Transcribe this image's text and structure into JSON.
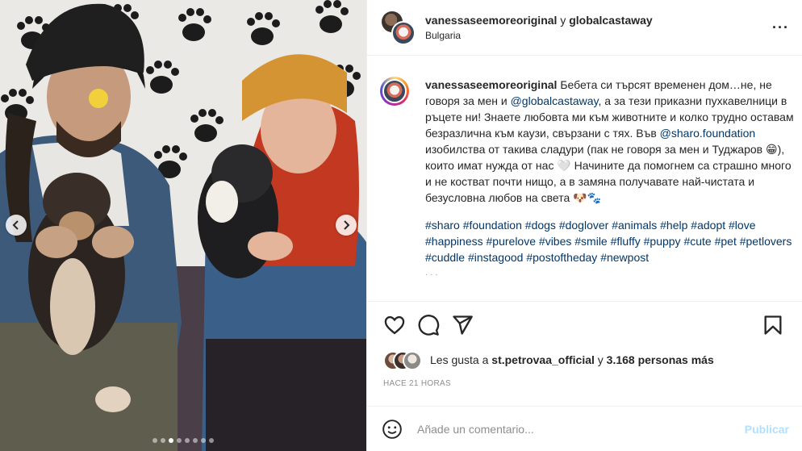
{
  "header": {
    "user1": "vanessaseemoreoriginal",
    "conjunction": "y",
    "user2": "globalcastaway",
    "location": "Bulgaria",
    "more_icon": "more-horizontal-icon"
  },
  "caption": {
    "username": "vanessaseemoreoriginal",
    "text_1": "Бебета си търсят временен дом…не, не говоря за мен и ",
    "mention_1": "@globalcastaway",
    "text_2": ", а за тези приказни пухкавелници в ръцете ни! Знаете любовта ми към животните и колко трудно оставам безразлична към каузи, свързани с тях. Във ",
    "mention_2": "@sharo.foundation",
    "text_3": " изобилства от такива сладури (пак не говоря за мен и Туджаров 😁), които имат нужда от нас 🤍 Начините да помогнем са страшно много и не костват почти нищо, а в замяна получавате най-чистата и безусловна любов на света 🐶🐾",
    "hashtags": [
      "#sharo",
      "#foundation",
      "#dogs",
      "#doglover",
      "#animals",
      "#help",
      "#adopt",
      "#love",
      "#happiness",
      "#purelove",
      "#vibes",
      "#smile",
      "#fluffy",
      "#puppy",
      "#cute",
      "#pet",
      "#petlovers",
      "#cuddle",
      "#instagood",
      "#postoftheday",
      "#newpost"
    ]
  },
  "likes": {
    "prefix": "Les gusta a",
    "user": "st.petrovaa_official",
    "middle": "y",
    "count": "3.168 personas más"
  },
  "timestamp": "HACE 21 HORAS",
  "comment": {
    "placeholder": "Añade un comentario...",
    "publish_label": "Publicar"
  },
  "carousel": {
    "total_slides": 8,
    "active_slide": 3
  }
}
